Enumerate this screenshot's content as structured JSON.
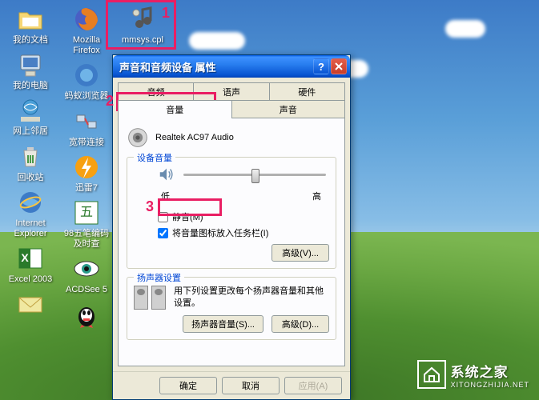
{
  "desktop": {
    "icons_col1": [
      {
        "label": "我的文档",
        "icon": "folder"
      },
      {
        "label": "我的电脑",
        "icon": "computer"
      },
      {
        "label": "网上邻居",
        "icon": "network"
      },
      {
        "label": "回收站",
        "icon": "recycle"
      },
      {
        "label": "Internet Explorer",
        "icon": "ie"
      },
      {
        "label": "Excel 2003",
        "icon": "excel"
      },
      {
        "label": "",
        "icon": "mail"
      }
    ],
    "icons_col2": [
      {
        "label": "Mozilla Firefox",
        "icon": "firefox"
      },
      {
        "label": "蚂蚁浏览器",
        "icon": "ant"
      },
      {
        "label": "宽带连接",
        "icon": "broadband"
      },
      {
        "label": "迅雷7",
        "icon": "thunder"
      },
      {
        "label": "98五笔编码及时查",
        "icon": "wubi"
      },
      {
        "label": "ACDSee 5",
        "icon": "acdsee"
      },
      {
        "label": "",
        "icon": "qq"
      }
    ],
    "icons_col3": [
      {
        "label": "mmsys.cpl",
        "icon": "mmsys"
      }
    ]
  },
  "dialog": {
    "title": "声音和音频设备 属性",
    "tabs_row1": [
      "音频",
      "语声",
      "硬件"
    ],
    "tabs_row2": [
      "音量",
      "声音"
    ],
    "audio_device": "Realtek AC97 Audio",
    "group_volume": "设备音量",
    "slider_low": "低",
    "slider_high": "高",
    "mute_label": "静音(M)",
    "taskbar_label": "将音量图标放入任务栏(I)",
    "advanced_btn": "高级(V)...",
    "group_speaker": "扬声器设置",
    "speaker_desc": "用下列设置更改每个扬声器音量和其他设置。",
    "speaker_vol_btn": "扬声器音量(S)...",
    "speaker_adv_btn": "高级(D)...",
    "ok_btn": "确定",
    "cancel_btn": "取消",
    "apply_btn": "应用(A)"
  },
  "annotations": {
    "n1": "1",
    "n2": "2",
    "n3": "3"
  },
  "watermark": {
    "main": "系统之家",
    "sub": "XITONGZHIJIA.NET"
  }
}
